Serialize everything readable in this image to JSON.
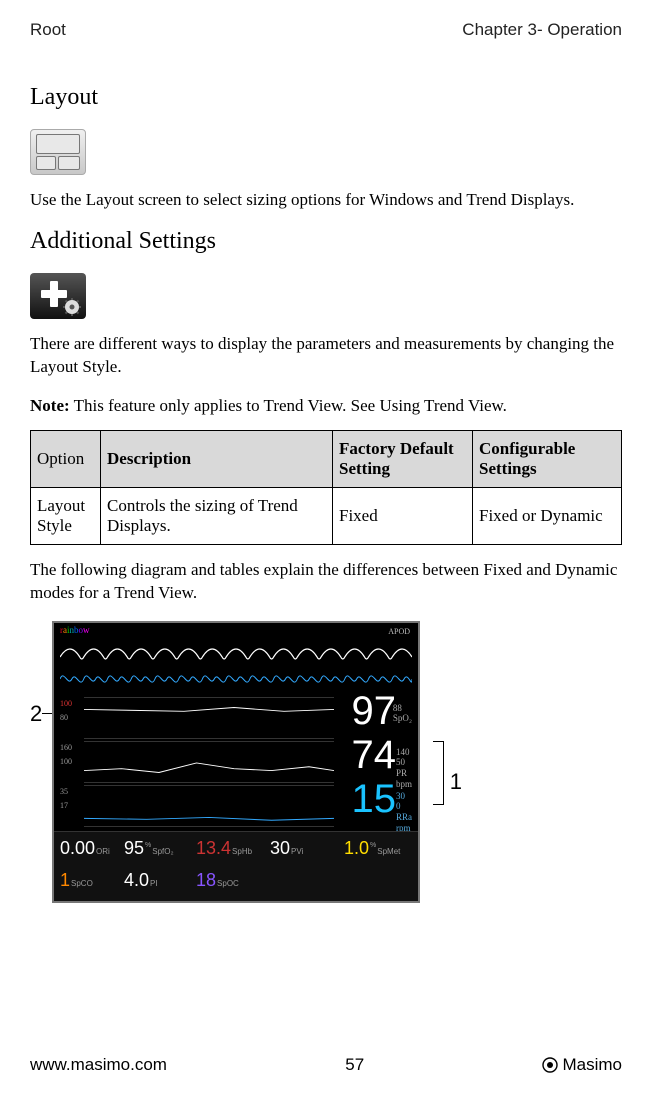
{
  "header": {
    "left": "Root",
    "right": "Chapter 3- Operation"
  },
  "s1": {
    "title": "Layout",
    "para": "Use the Layout screen to select sizing options for Windows and Trend Displays."
  },
  "s2": {
    "title": "Additional Settings",
    "para": "There are different ways to display the parameters and measurements by changing the Layout Style.",
    "note_label": "Note:",
    "note_text": " This feature only applies to Trend View. See Using Trend View."
  },
  "table": {
    "headers": {
      "c1": "Option",
      "c2": "Description",
      "c3": "Factory Default Setting",
      "c4": "Configurable Settings"
    },
    "row": {
      "c1": "Layout Style",
      "c2": "Controls the sizing of Trend Displays.",
      "c3": "Fixed",
      "c4": "Fixed or Dynamic"
    }
  },
  "s3": {
    "para": "The following diagram and tables explain the differences between Fixed and Dynamic modes for a Trend View."
  },
  "diagram": {
    "brand_letters": [
      "r",
      "a",
      "i",
      "n",
      "b",
      "o",
      "w"
    ],
    "apod": "APOD",
    "callout1": "1",
    "callout2": "2",
    "rows": {
      "r1": {
        "y_hi": "100",
        "y_lo": "80",
        "value": "97",
        "unit_top": "88",
        "unit_bot": "SpO₂"
      },
      "r2": {
        "y_hi": "160",
        "y_lo": "100",
        "value": "74",
        "unit_top": "140\n50",
        "unit_bot": "PR\nbpm"
      },
      "r3": {
        "y_hi": "35",
        "y_lo": "17",
        "value": "15",
        "unit_top": "30\n0",
        "unit_bot": "RRa\nrpm"
      }
    },
    "minis": {
      "m1": {
        "top_val": "0.00",
        "top_lab": "ORi",
        "bot_val": "1",
        "bot_lab": "SpCO",
        "bot_color": "#f80"
      },
      "m2": {
        "top_val": "95",
        "top_sup": "%",
        "top_lab": "SpfO₂",
        "bot_val": "4.0",
        "bot_lab": "PI",
        "bot_color": "#fff"
      },
      "m3": {
        "top_val": "13.4",
        "top_lab": "SpHb",
        "top_color": "#c33",
        "bot_val": "18",
        "bot_lab": "SpOC",
        "bot_color": "#85f"
      },
      "m4": {
        "top_val": "30",
        "top_lab": "PVi",
        "top_color": "#fff"
      },
      "m5": {
        "top_val": "1.0",
        "top_sup": "%",
        "top_lab": "SpMet",
        "top_color": "#fd0"
      }
    }
  },
  "footer": {
    "url": "www.masimo.com",
    "page": "57",
    "brand": "Masimo"
  }
}
